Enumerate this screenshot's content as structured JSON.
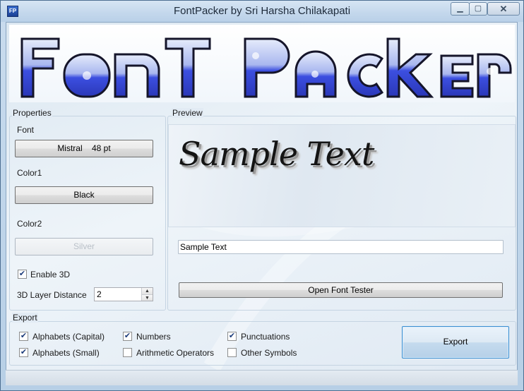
{
  "window": {
    "title": "FontPacker by Sri Harsha Chilakapati",
    "app_icon_text": "FP"
  },
  "banner": {
    "text": "FONT PACKER",
    "colors": {
      "fill_top": "#b8c6f2",
      "fill_bottom": "#2f3fd1",
      "outline": "#1b1b2e"
    }
  },
  "properties": {
    "group_label": "Properties",
    "font_label": "Font",
    "font_button": "Mistral    48 pt",
    "color1_label": "Color1",
    "color1_button": "Black",
    "color2_label": "Color2",
    "color2_button": "Silver",
    "enable3d_label": "Enable 3D",
    "enable3d_checked": true,
    "layer_distance_label": "3D Layer Distance",
    "layer_distance_value": "2"
  },
  "preview": {
    "group_label": "Preview",
    "sample_display": "Sample Text",
    "sample_input_value": "Sample Text",
    "open_tester_button": "Open Font Tester"
  },
  "export": {
    "group_label": "Export",
    "options": [
      {
        "label": "Alphabets (Capital)",
        "checked": true
      },
      {
        "label": "Alphabets (Small)",
        "checked": true
      },
      {
        "label": "Numbers",
        "checked": true
      },
      {
        "label": "Arithmetic Operators",
        "checked": false
      },
      {
        "label": "Punctuations",
        "checked": true
      },
      {
        "label": "Other Symbols",
        "checked": false
      }
    ],
    "export_button": "Export"
  }
}
